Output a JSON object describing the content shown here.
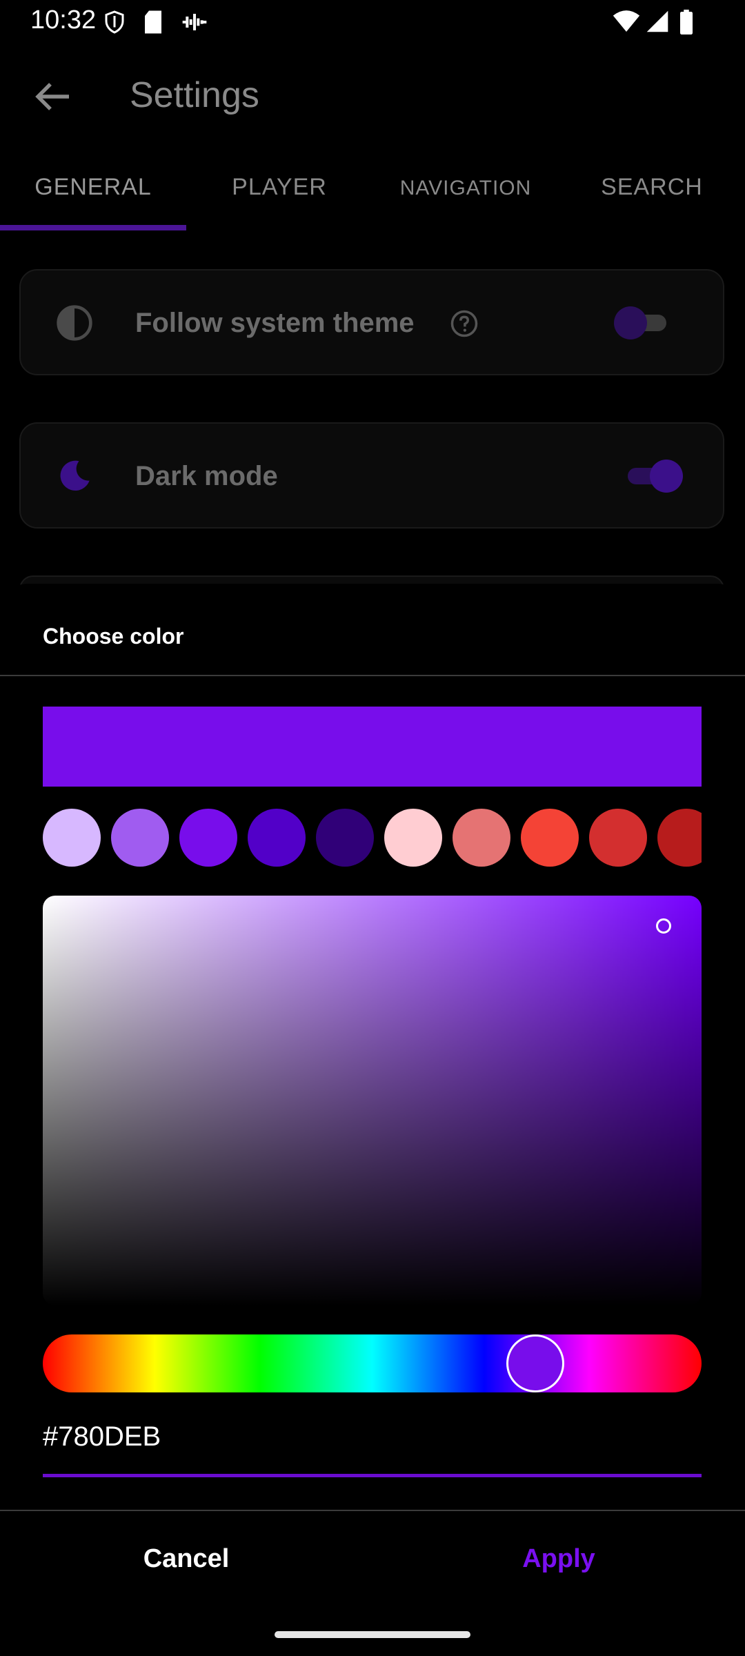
{
  "status_bar": {
    "time": "10:32"
  },
  "app_bar": {
    "title": "Settings"
  },
  "tabs": [
    {
      "label": "GENERAL"
    },
    {
      "label": "PLAYER"
    },
    {
      "label": "NAVIGATION"
    },
    {
      "label": "SEARCH"
    }
  ],
  "settings": {
    "follow_system_theme": {
      "label": "Follow system theme",
      "enabled": false
    },
    "dark_mode": {
      "label": "Dark mode",
      "enabled": true
    }
  },
  "color_dialog": {
    "title": "Choose color",
    "selected_color": "#780DEB",
    "hex_value": "#780DEB",
    "swatches": [
      "#d7b8ff",
      "#a05cf0",
      "#780deb",
      "#5200c8",
      "#300078",
      "#ffcdd2",
      "#e57373",
      "#f44336",
      "#d32f2f",
      "#b71c1c"
    ],
    "cancel_label": "Cancel",
    "apply_label": "Apply"
  },
  "colors": {
    "accent": "#780DEB",
    "background": "#000000",
    "muted_text": "#8a8a8a"
  }
}
